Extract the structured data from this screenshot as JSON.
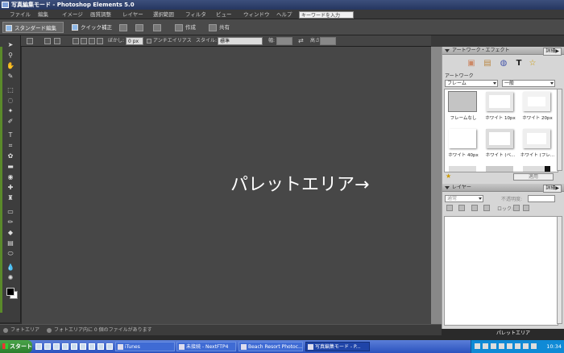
{
  "window": {
    "title": "写真編集モード - Photoshop Elements 5.0"
  },
  "menu": {
    "items": [
      "ファイル",
      "編集",
      "イメージ",
      "画質調整",
      "レイヤー",
      "選択範囲",
      "フィルタ",
      "ビュー",
      "ウィンドウ",
      "ヘルプ"
    ],
    "search_placeholder": "キーワードを入力"
  },
  "modes": {
    "standard": "スタンダード編集",
    "quick": "クイック補正",
    "create": "作成",
    "share": "共有"
  },
  "options_bar": {
    "feather_label": "ぼかし:",
    "feather_value": "0 px",
    "antialias_label": "アンチエイリアス",
    "style_label": "スタイル:",
    "style_value": "標準",
    "width_label": "幅:",
    "height_label": "高さ:"
  },
  "canvas": {
    "annotation": "パレットエリア→"
  },
  "artwork_panel": {
    "title": "アートワーク・エフェクト",
    "more": "詳細▶",
    "section_label": "アートワーク",
    "category_value": "フレーム",
    "subcategory_value": "一般",
    "thumbnails": [
      "フレームなし",
      "ホワイト 10px",
      "ホワイト 20px",
      "ホワイト 40px",
      "ホワイト (ベ...",
      "ホワイト (フレ...",
      "",
      "",
      ""
    ],
    "apply_button": "適用"
  },
  "layers_panel": {
    "title": "レイヤー",
    "more": "詳細▶",
    "blend_mode": "通常",
    "opacity_label": "不透明度:",
    "lock_label": "ロック:"
  },
  "status_bar": {
    "photo_area": "フォトエリア",
    "message": "フォトエリア内に 0 個のファイルがあります"
  },
  "palette_bin": {
    "label": "パレットエリア"
  },
  "taskbar": {
    "start": "スタート",
    "tasks": [
      "iTunes",
      "未接続 - NextFTP4",
      "Beach Resort Photoc...",
      "写真編集モード - P..."
    ],
    "clock": "10:34"
  }
}
